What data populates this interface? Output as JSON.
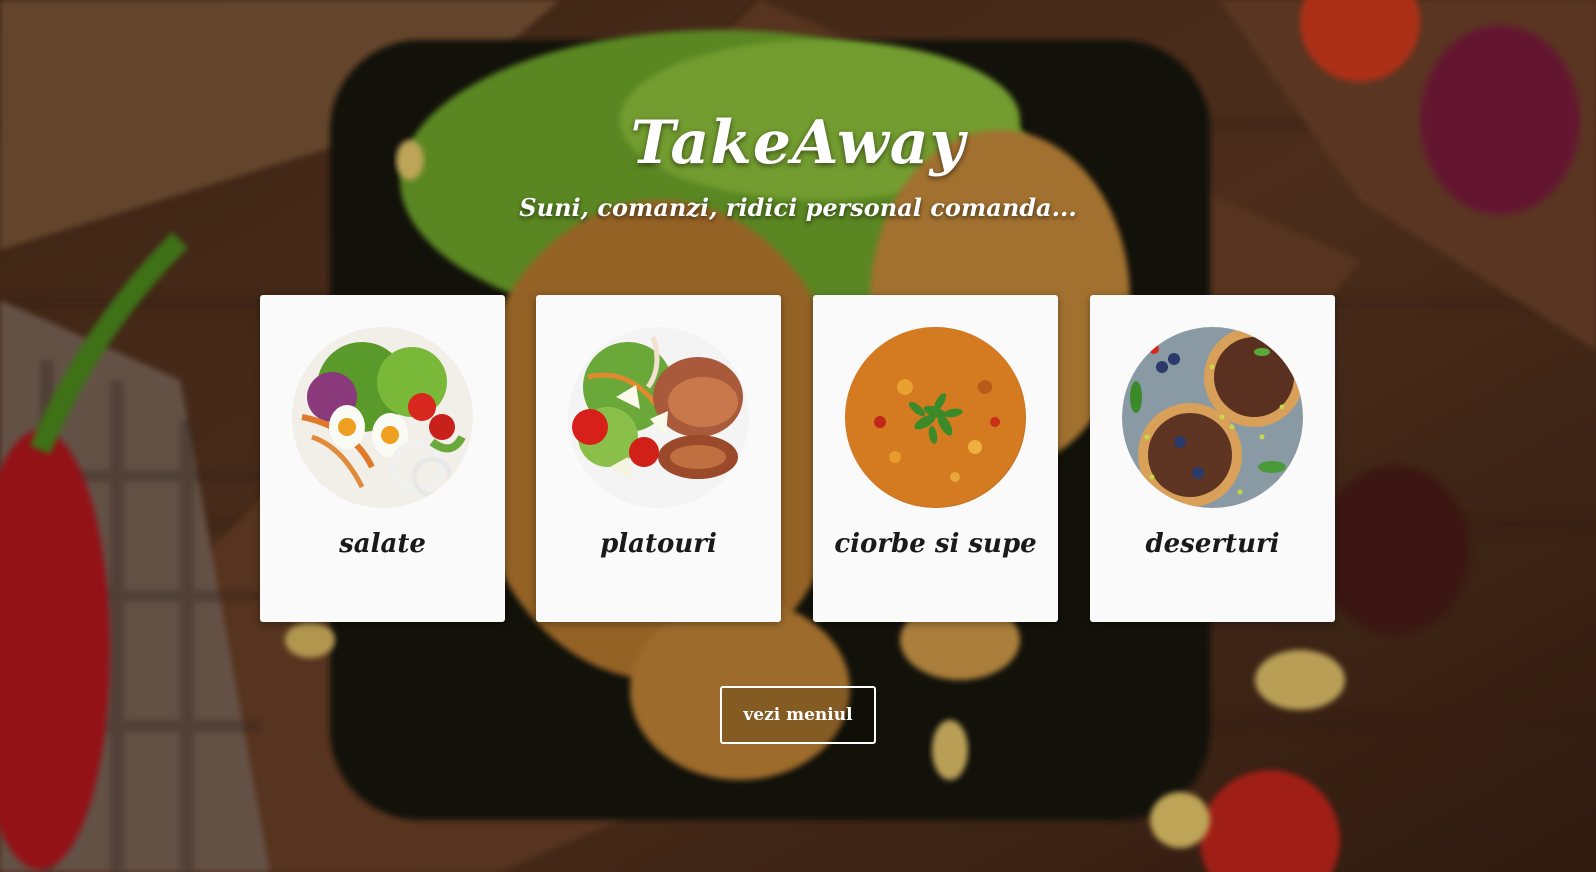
{
  "hero": {
    "title": "TakeAway",
    "subtitle": "Suni, comanzi, ridici personal comanda..."
  },
  "categories": [
    {
      "label": "salate",
      "icon": "salad-photo"
    },
    {
      "label": "platouri",
      "icon": "platter-photo"
    },
    {
      "label": "ciorbe si supe",
      "icon": "soup-photo"
    },
    {
      "label": "deserturi",
      "icon": "dessert-photo"
    }
  ],
  "cta": {
    "label": "vezi meniul"
  },
  "colors": {
    "card_background": "#fafafa",
    "text_light": "#ffffff",
    "text_dark": "#1a1a1a",
    "wood": "#5a3520"
  }
}
